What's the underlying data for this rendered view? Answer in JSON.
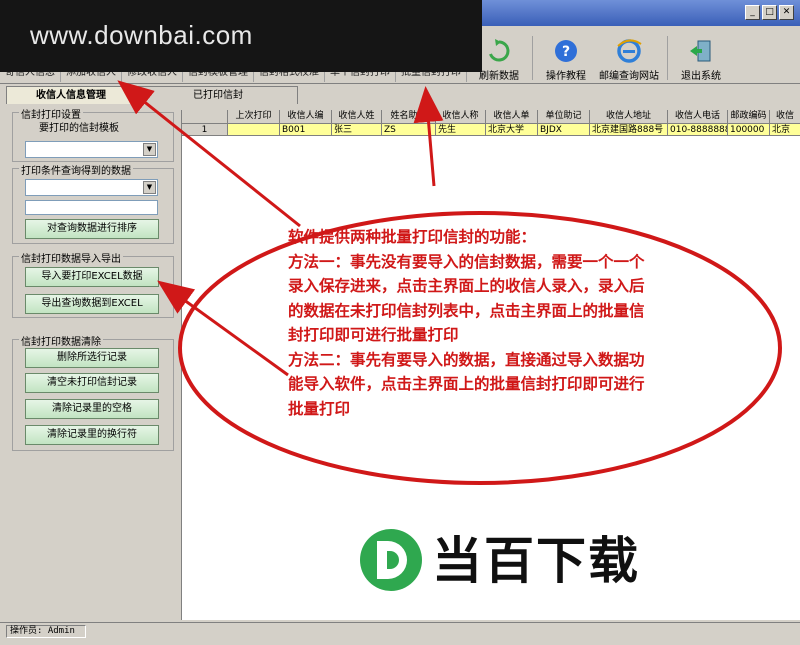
{
  "watermark": {
    "url_text": "www.downbai.com"
  },
  "window": {
    "title": "",
    "controls": [
      "_",
      "□",
      "✕"
    ]
  },
  "toolbar": {
    "text_items": [
      "寄信人信息",
      "添加收信人",
      "修改收信人",
      "信封模板管理",
      "信封格式校准",
      "单个信封打印",
      "批量信封打印"
    ],
    "buttons": [
      {
        "label": "刷新数据",
        "icon": "refresh-icon"
      },
      {
        "label": "操作教程",
        "icon": "help-icon"
      },
      {
        "label": "邮编查询网站",
        "icon": "ie-globe-icon"
      },
      {
        "label": "退出系统",
        "icon": "exit-door-icon"
      }
    ]
  },
  "tabs": [
    {
      "label": "收信人信息管理",
      "active": true
    },
    {
      "label": "已打印信封",
      "active": false
    }
  ],
  "left": {
    "print_settings": {
      "title": "信封打印设置",
      "template_label": "要打印的信封模板"
    },
    "query": {
      "title": "打印条件查询得到的数据",
      "sort_button": "对查询数据进行排序"
    },
    "import_export": {
      "title": "信封打印数据导入导出",
      "import_button": "导入要打印EXCEL数据",
      "export_button": "导出查询数据到EXCEL"
    },
    "clear": {
      "title": "信封打印数据清除",
      "buttons": [
        "删除所选行记录",
        "清空未打印信封记录",
        "清除记录里的空格",
        "清除记录里的换行符"
      ]
    }
  },
  "grid": {
    "columns": [
      "",
      "上次打印",
      "收信人编",
      "收信人姓",
      "姓名助记",
      "收信人称",
      "收信人单",
      "单位助记",
      "收信人地址",
      "收信人电话",
      "邮政编码",
      "收信"
    ],
    "rows": [
      [
        "1",
        "",
        "B001",
        "张三",
        "ZS",
        "先生",
        "北京大学",
        "BJDX",
        "北京建国路888号",
        "010-88888888",
        "100000",
        "北京"
      ]
    ]
  },
  "annotation": {
    "color": "#d01818",
    "lines": [
      "软件提供两种批量打印信封的功能：",
      "方法一：事先没有要导入的信封数据，需要一个一个",
      "录入保存进来，点击主界面上的收信人录入，录入后",
      "的数据在未打印信封列表中，点击主界面上的批量信",
      "封打印即可进行批量打印",
      "方法二：事先有要导入的数据，直接通过导入数据功",
      "能导入软件，点击主界面上的批量信封打印即可进行",
      "批量打印"
    ]
  },
  "brand": {
    "letter": "D",
    "text": "当百下载",
    "color": "#2fa84f"
  },
  "status": {
    "operator": "操作员: Admin"
  }
}
